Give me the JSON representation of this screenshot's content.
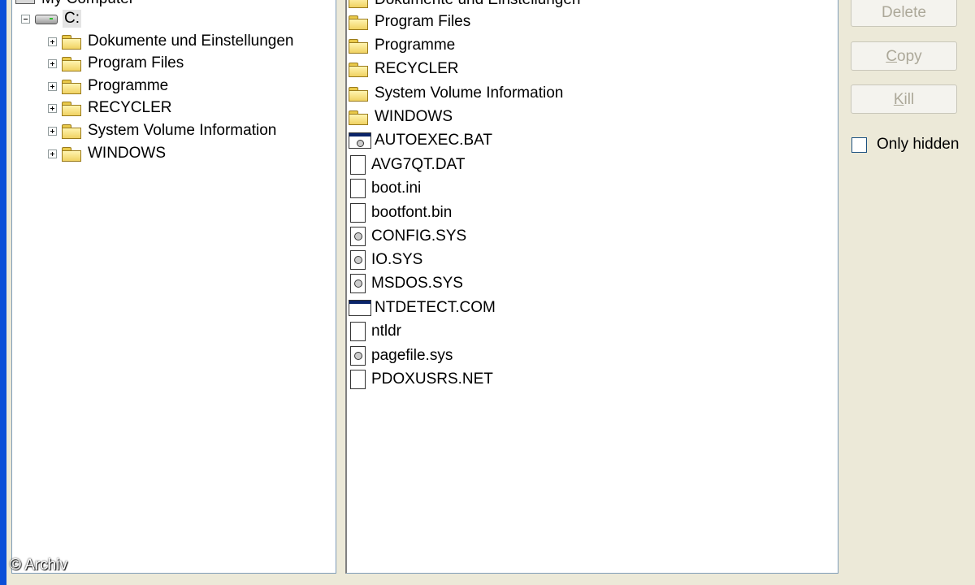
{
  "tree": {
    "root_label": "My Computer",
    "drive_label": "C:",
    "folders": [
      {
        "label": "Dokumente und Einstellungen"
      },
      {
        "label": "Program Files"
      },
      {
        "label": "Programme"
      },
      {
        "label": "RECYCLER"
      },
      {
        "label": "System Volume Information"
      },
      {
        "label": "WINDOWS"
      }
    ]
  },
  "file_list": {
    "items": [
      {
        "label": "Dokumente und Einstellungen",
        "icon": "folder-icon"
      },
      {
        "label": "Program Files",
        "icon": "folder-icon"
      },
      {
        "label": "Programme",
        "icon": "folder-icon"
      },
      {
        "label": "RECYCLER",
        "icon": "folder-icon"
      },
      {
        "label": "System Volume Information",
        "icon": "folder-icon"
      },
      {
        "label": "WINDOWS",
        "icon": "folder-icon"
      },
      {
        "label": "AUTOEXEC.BAT",
        "icon": "batch-file-icon"
      },
      {
        "label": "AVG7QT.DAT",
        "icon": "file-icon"
      },
      {
        "label": "boot.ini",
        "icon": "file-icon"
      },
      {
        "label": "bootfont.bin",
        "icon": "file-icon"
      },
      {
        "label": "CONFIG.SYS",
        "icon": "system-file-icon"
      },
      {
        "label": "IO.SYS",
        "icon": "system-file-icon"
      },
      {
        "label": "MSDOS.SYS",
        "icon": "system-file-icon"
      },
      {
        "label": "NTDETECT.COM",
        "icon": "executable-icon"
      },
      {
        "label": "ntldr",
        "icon": "file-icon"
      },
      {
        "label": "pagefile.sys",
        "icon": "system-file-icon"
      },
      {
        "label": "PDOXUSRS.NET",
        "icon": "file-icon"
      }
    ]
  },
  "buttons": {
    "delete_label": "Delete",
    "copy_first": "C",
    "copy_rest": "opy",
    "kill_first": "K",
    "kill_rest": "ill"
  },
  "options": {
    "only_hidden_label": "Only hidden",
    "only_hidden_checked": false
  },
  "watermark": "© Archiv",
  "colors": {
    "window_frame": "#0b4fd8",
    "dialog_face": "#ece9d8",
    "disabled_text": "#aca899"
  }
}
